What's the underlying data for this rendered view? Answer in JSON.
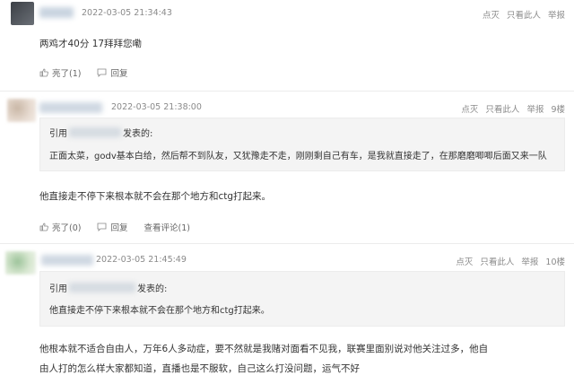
{
  "actions": {
    "dislike": "点灭",
    "only_this": "只看此人",
    "report": "举报"
  },
  "posts": [
    {
      "timestamp": "2022-03-05 21:34:43",
      "floor": "",
      "content_lines": [
        "两鸡才40分 17拜拜您嘞"
      ],
      "like_label": "亮了(1)",
      "reply_label": "回复",
      "view_comments": ""
    },
    {
      "timestamp": "2022-03-05 21:38:00",
      "floor": "9楼",
      "quote_prefix": "引用",
      "quote_suffix": "发表的:",
      "quote_body": "正面太菜，godv基本白给，然后帮不到队友，又犹豫走不走，刚刚剩自己有车，是我就直接走了，在那磨磨唧唧后面又来一队",
      "content_lines": [
        "他直接走不停下来根本就不会在那个地方和ctg打起来。"
      ],
      "like_label": "亮了(0)",
      "reply_label": "回复",
      "view_comments": "查看评论(1)"
    },
    {
      "timestamp": "2022-03-05 21:45:49",
      "floor": "10楼",
      "quote_prefix": "引用",
      "quote_suffix": "发表的:",
      "quote_body": "他直接走不停下来根本就不会在那个地方和ctg打起来。",
      "content_lines": [
        "他根本就不适合自由人，万年6人多动症，要不然就是我赌对面看不见我，联赛里面别说对他关注过多，他自",
        "由人打的怎么样大家都知道，直播也是不服软，自己这么打没问题，运气不好"
      ],
      "like_label": "",
      "reply_label": "",
      "view_comments": ""
    }
  ],
  "colors": {
    "meta": "#8a8a8a",
    "quote_bg": "#f4f4f4",
    "text": "#333333"
  }
}
